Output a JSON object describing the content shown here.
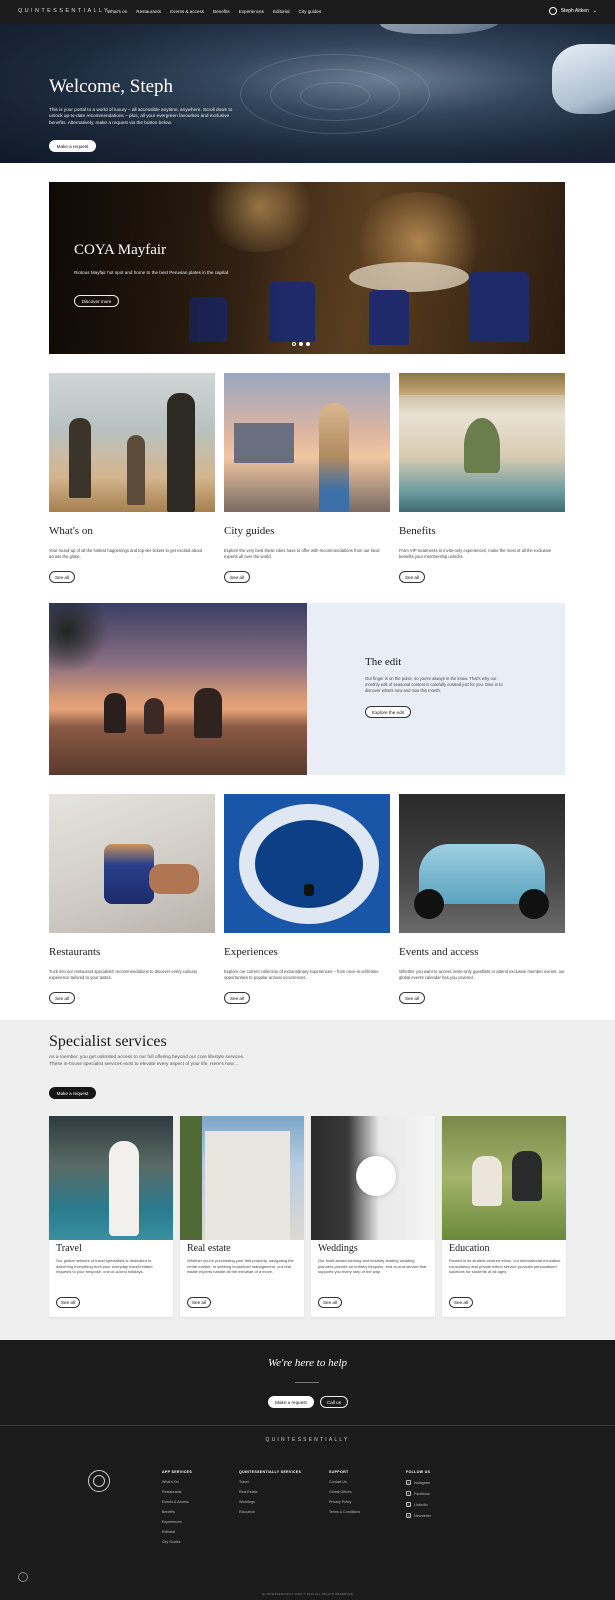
{
  "nav": {
    "brand": "QUINTESSENTIALLY",
    "links": [
      "What's on",
      "Restaurants",
      "Events & access",
      "Benefits",
      "Experiences",
      "Editorial",
      "City guides"
    ],
    "user": "Steph Aitken",
    "user_icon": "user-circle-icon"
  },
  "hero": {
    "title": "Welcome, Steph",
    "text": "This is your portal to a world of luxury – all accessible anytime, anywhere. Scroll down to unlock up-to-date recommendations – plus, all your evergreen favourites and exclusive benefits. Alternatively, make a request via the button below.",
    "button": "Make a request"
  },
  "feature": {
    "title": "COYA Mayfair",
    "text": "Riotous Mayfair hot spot and home to the best Peruvian plates in the capital.",
    "button": "Discover more",
    "slides_total": 3,
    "slide_active": 2
  },
  "cards_top": [
    {
      "title": "What's on",
      "text": "Your round-up of all the hottest happenings and top-tier tickets to get excited about across the globe.",
      "button": "See all"
    },
    {
      "title": "City guides",
      "text": "Explore the very best these cities have to offer with recommendations from our local experts all over the world.",
      "button": "See all"
    },
    {
      "title": "Benefits",
      "text": "From VIP treatments to invite-only experiences, make the most of all the exclusive benefits your membership unlocks.",
      "button": "See all"
    }
  ],
  "edit": {
    "title": "The edit",
    "text": "Our finger is on the pulse, so you're always in the know. That's why our monthly edit of seasonal content is carefully curated just for you. Dive in to discover what's new and now this month.",
    "button": "Explore the edit"
  },
  "cards_bottom": [
    {
      "title": "Restaurants",
      "text": "Tuck into our restaurant specialists' recommendations to discover every culinary experience tailored to your tastes.",
      "button": "See all"
    },
    {
      "title": "Experiences",
      "text": "Explore our current collection of extraordinary experiences – from once-in-a-lifetime opportunities to popular annual occurrences.",
      "button": "See all"
    },
    {
      "title": "Events and access",
      "text": "Whether you want to access invite-only guestlists or attend exclusive member events, our global events calendar has you covered.",
      "button": "See all"
    }
  ],
  "specialist": {
    "title": "Specialist services",
    "text": "As a member, you get unlimited access to our full offering beyond our core lifestyle services. These in-house specialist services exist to elevate every aspect of your life. Here's how…",
    "button": "Make a request",
    "cards": [
      {
        "title": "Travel",
        "text": "Our global network of travel specialists is dedicated to delivering everything from your everyday travel-related requests to your bespoke, one-of-a-kind holidays.",
        "button": "See all"
      },
      {
        "title": "Real estate",
        "text": "Whether you're purchasing your first property, navigating the rental market, or seeking household management, our real estate experts handle all the minutiae of a move.",
        "button": "See all"
      },
      {
        "title": "Weddings",
        "text": "Our multi-award-winning and industry-leading wedding planners provide an entirely bespoke, end-to-end service that supports you every step of the way.",
        "button": "See all"
      },
      {
        "title": "Education",
        "text": "Rooted in its student-centred ethos, our international education consultancy and private tuition service provides personalised solutions for students of all ages.",
        "button": "See all"
      }
    ]
  },
  "help": {
    "title": "We're here to help",
    "request_button": "Make a request",
    "call_button": "Call us"
  },
  "footer": {
    "brand": "QUINTESSENTIALLY",
    "columns": [
      {
        "heading": "APP SERVICES",
        "links": [
          "What's On",
          "Restaurants",
          "Events & Access",
          "Benefits",
          "Experiences",
          "Editorial",
          "City Guides"
        ]
      },
      {
        "heading": "QUINTESSENTIALLY SERVICES",
        "links": [
          "Travel",
          "Real Estate",
          "Weddings",
          "Education"
        ]
      },
      {
        "heading": "SUPPORT",
        "links": [
          "Contact Us",
          "Global Offices",
          "Privacy Policy",
          "Terms & Conditions"
        ]
      },
      {
        "heading": "FOLLOW US",
        "links": [
          "Instagram",
          "Facebook",
          "LinkedIn",
          "Newsletter"
        ]
      }
    ],
    "social_icons": [
      "instagram-icon",
      "facebook-icon",
      "linkedin-icon",
      "mail-icon"
    ],
    "copyright": "QUINTESSENTIALLY.COM © 2024 ALL RIGHTS RESERVED"
  },
  "colors": {
    "dark": "#1b1b1b",
    "edit_panel": "#e9eef6",
    "specialist_bg": "#efefef"
  }
}
